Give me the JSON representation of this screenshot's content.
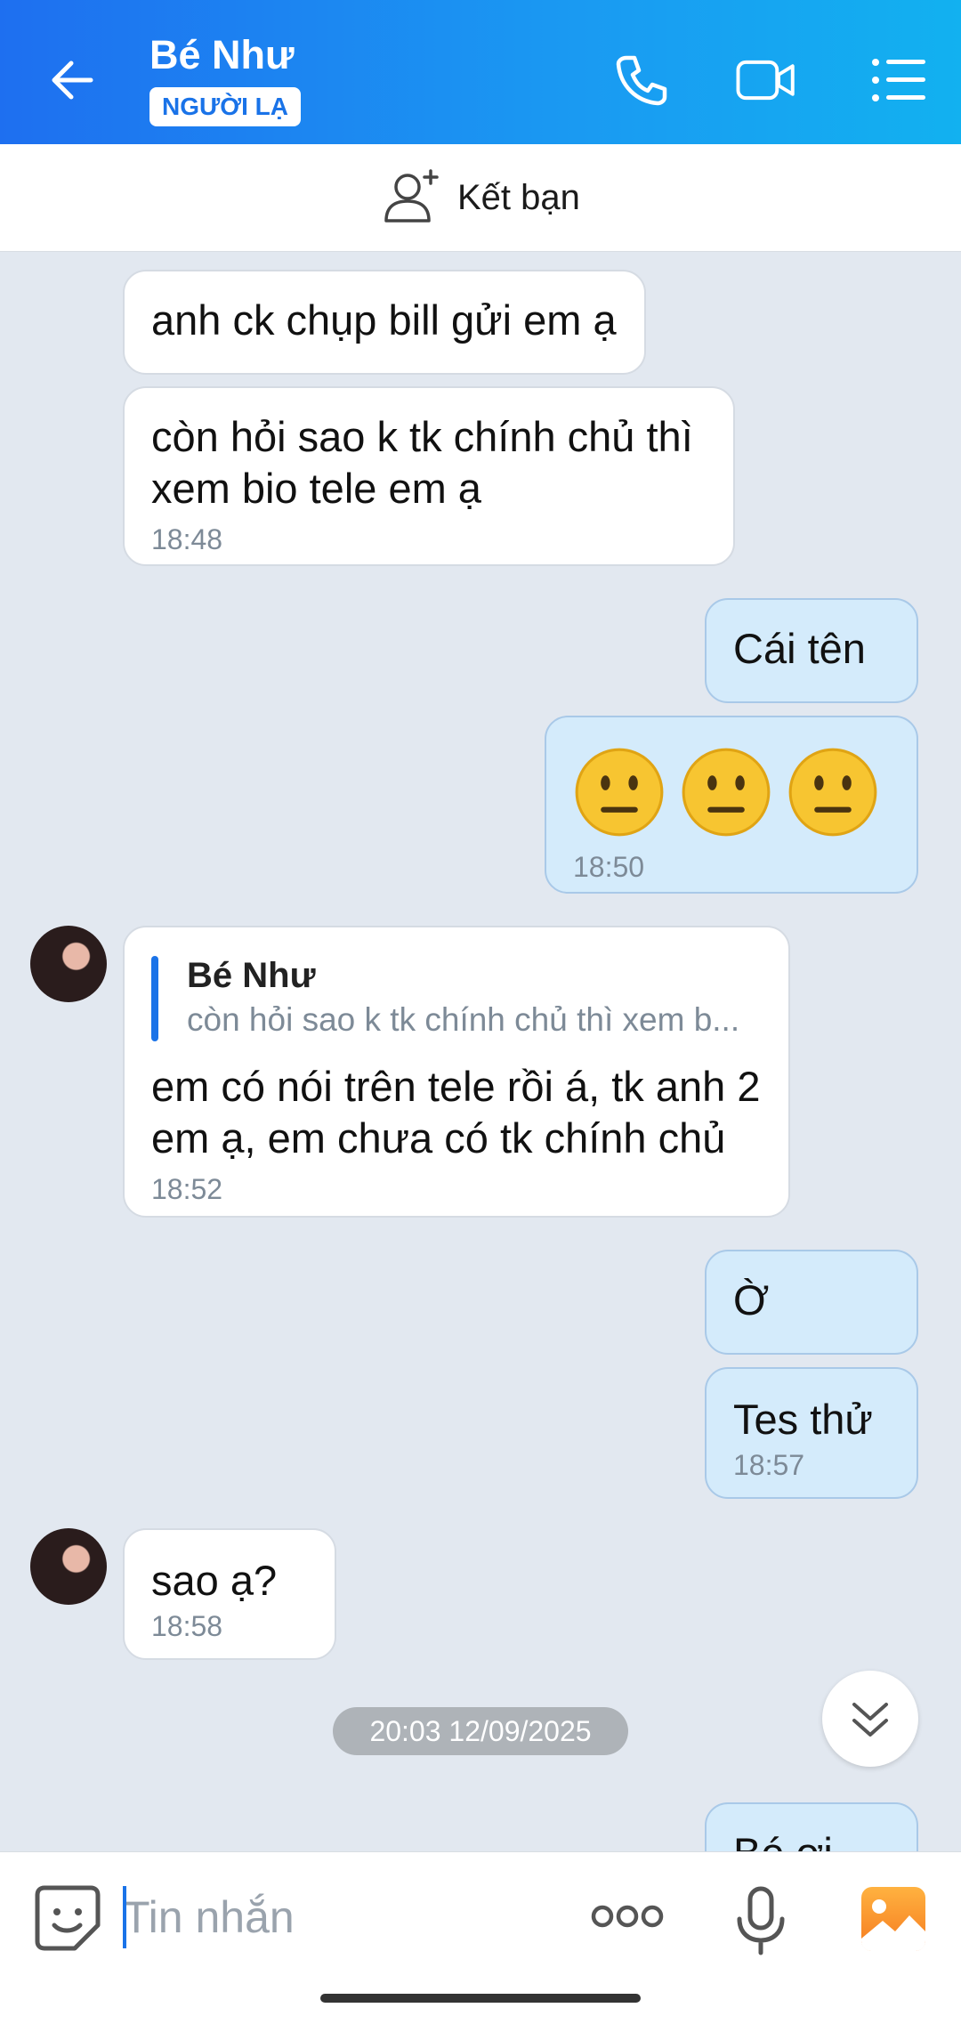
{
  "header": {
    "title": "Bé Như",
    "badge": "NGƯỜI LẠ"
  },
  "add_friend": {
    "label": "Kết bạn"
  },
  "messages": [
    {
      "text": "anh ck chụp bill gửi em ạ"
    },
    {
      "text": "còn hỏi sao k tk chính chủ thì xem bio tele em ạ",
      "time": "18:48"
    },
    {
      "text": "Cái tên"
    },
    {
      "emojis": "😐😐😐",
      "time": "18:50"
    },
    {
      "quote_name": "Bé Như",
      "quote_text": "còn hỏi sao k tk chính chủ thì xem b...",
      "text": "em có nói trên tele rồi á, tk anh 2 em ạ, em chưa có tk chính chủ",
      "time": "18:52"
    },
    {
      "text": "Ờ"
    },
    {
      "text": "Tes thử",
      "time": "18:57"
    },
    {
      "text": "sao ạ?",
      "time": "18:58"
    },
    {
      "text": "Bé ơi"
    }
  ],
  "date_separator": "20:03 12/09/2025",
  "composer": {
    "placeholder": "Tin nhắn"
  },
  "colors": {
    "header_start": "#1e6ff0",
    "header_end": "#12b1f0",
    "outgoing": "#d4ebfb",
    "incoming": "#ffffff",
    "accent": "#1a73e8"
  }
}
